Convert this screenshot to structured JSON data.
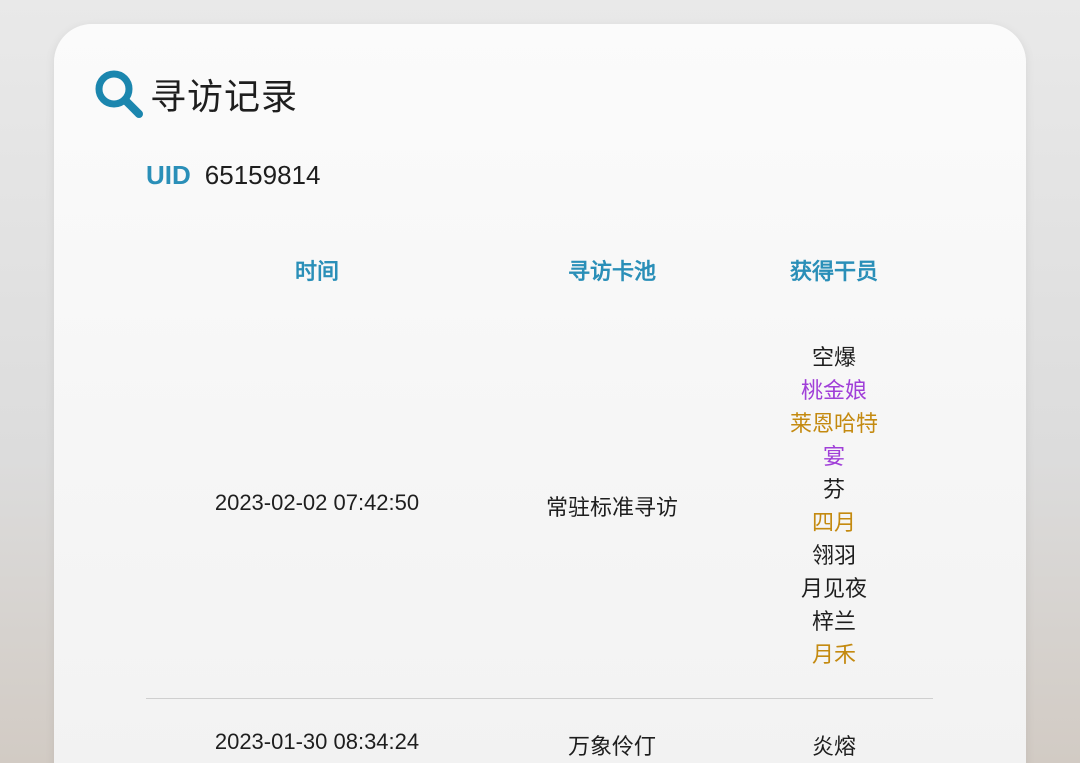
{
  "header": {
    "icon": "search-icon",
    "title": "寻访记录"
  },
  "uid": {
    "label": "UID",
    "value": "65159814"
  },
  "table": {
    "columns": [
      "时间",
      "寻访卡池",
      "获得干员"
    ],
    "rows": [
      {
        "time": "2023-02-02 07:42:50",
        "pool": "常驻标准寻访",
        "characters": [
          {
            "name": "空爆",
            "rarity": 3
          },
          {
            "name": "桃金娘",
            "rarity": 4
          },
          {
            "name": "莱恩哈特",
            "rarity": 5
          },
          {
            "name": "宴",
            "rarity": 4
          },
          {
            "name": "芬",
            "rarity": 3
          },
          {
            "name": "四月",
            "rarity": 5
          },
          {
            "name": "翎羽",
            "rarity": 3
          },
          {
            "name": "月见夜",
            "rarity": 3
          },
          {
            "name": "梓兰",
            "rarity": 3
          },
          {
            "name": "月禾",
            "rarity": 5
          }
        ]
      },
      {
        "time": "2023-01-30 08:34:24",
        "pool": "万象伶仃",
        "characters": [
          {
            "name": "炎熔",
            "rarity": 3
          }
        ]
      }
    ]
  },
  "colors": {
    "accent": "#2a8fb8",
    "text": "#1e1e1e",
    "rarity_3": "#1e1e1e",
    "rarity_4": "#a03fd8",
    "rarity_5": "#c48a10",
    "divider": "#cfcfcf"
  }
}
